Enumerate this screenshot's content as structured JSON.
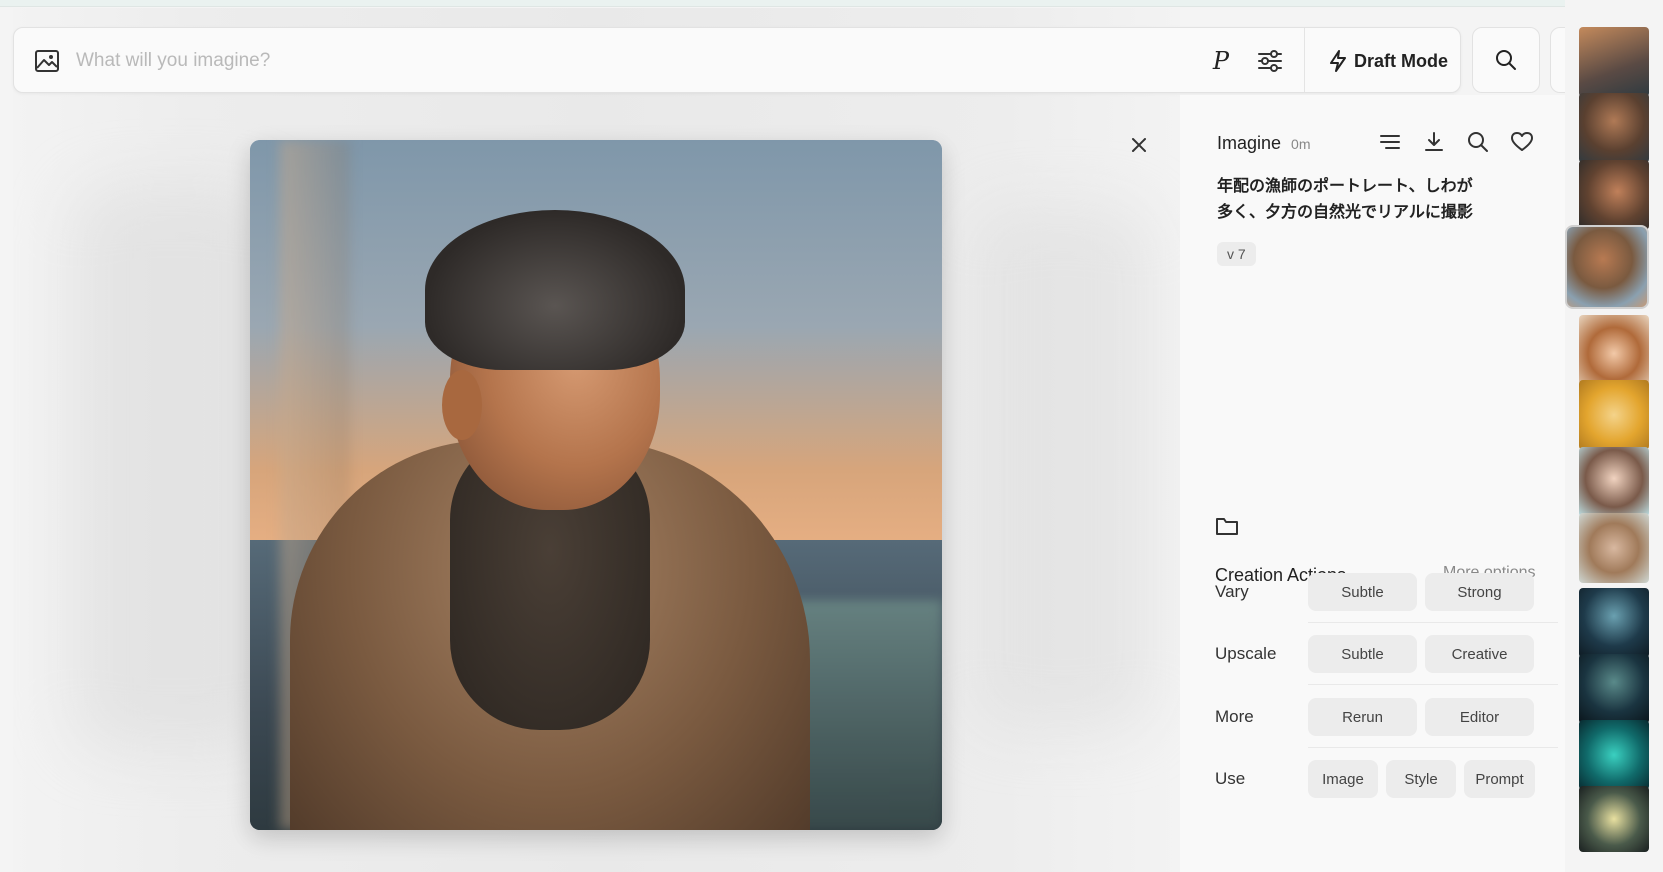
{
  "prompt_bar": {
    "placeholder": "What will you imagine?",
    "p_label": "P",
    "draft_mode_label": "Draft Mode"
  },
  "detail": {
    "title": "Imagine",
    "time": "0m",
    "prompt_line1": "年配の漁師のポートレート、しわが",
    "prompt_line2": "多く、夕方の自然光でリアルに撮影",
    "version": "v 7",
    "actions_title": "Creation Actions",
    "more_options": "More options",
    "rows": [
      {
        "label": "Vary",
        "buttons": [
          "Subtle",
          "Strong"
        ]
      },
      {
        "label": "Upscale",
        "buttons": [
          "Subtle",
          "Creative"
        ]
      },
      {
        "label": "More",
        "buttons": [
          "Rerun",
          "Editor"
        ]
      },
      {
        "label": "Use",
        "buttons": [
          "Image",
          "Style",
          "Prompt"
        ]
      }
    ]
  },
  "colors": {
    "background": "#f4f4f4",
    "panel": "#f9f9f9",
    "chip": "#ececec"
  }
}
